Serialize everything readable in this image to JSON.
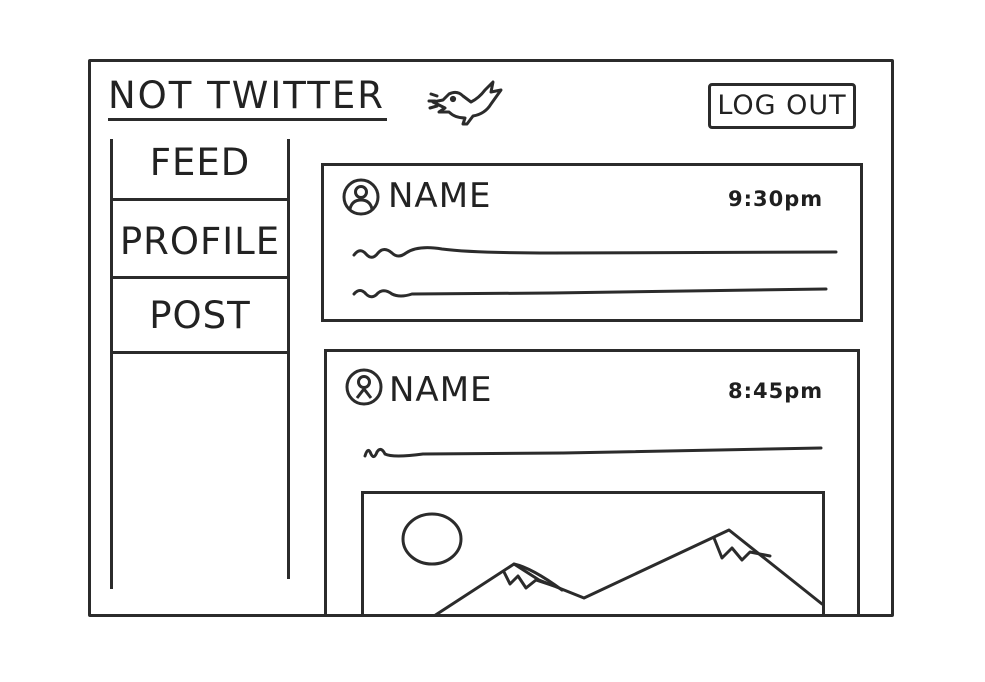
{
  "header": {
    "app_title": "NOT TWITTER",
    "logo_icon": "bird-icon",
    "logout_label": "LOG OUT"
  },
  "sidebar": {
    "items": [
      {
        "label": "FEED"
      },
      {
        "label": "PROFILE"
      },
      {
        "label": "POST"
      }
    ]
  },
  "feed": {
    "posts": [
      {
        "name": "NAME",
        "time": "9:30pm",
        "avatar_icon": "user-icon",
        "text_lines": 2,
        "has_image": false
      },
      {
        "name": "NAME",
        "time": "8:45pm",
        "avatar_icon": "user-icon",
        "text_lines": 1,
        "has_image": true,
        "image_icon": "landscape-image-icon"
      }
    ]
  },
  "colors": {
    "ink": "#2b2b2b",
    "paper": "#ffffff"
  }
}
